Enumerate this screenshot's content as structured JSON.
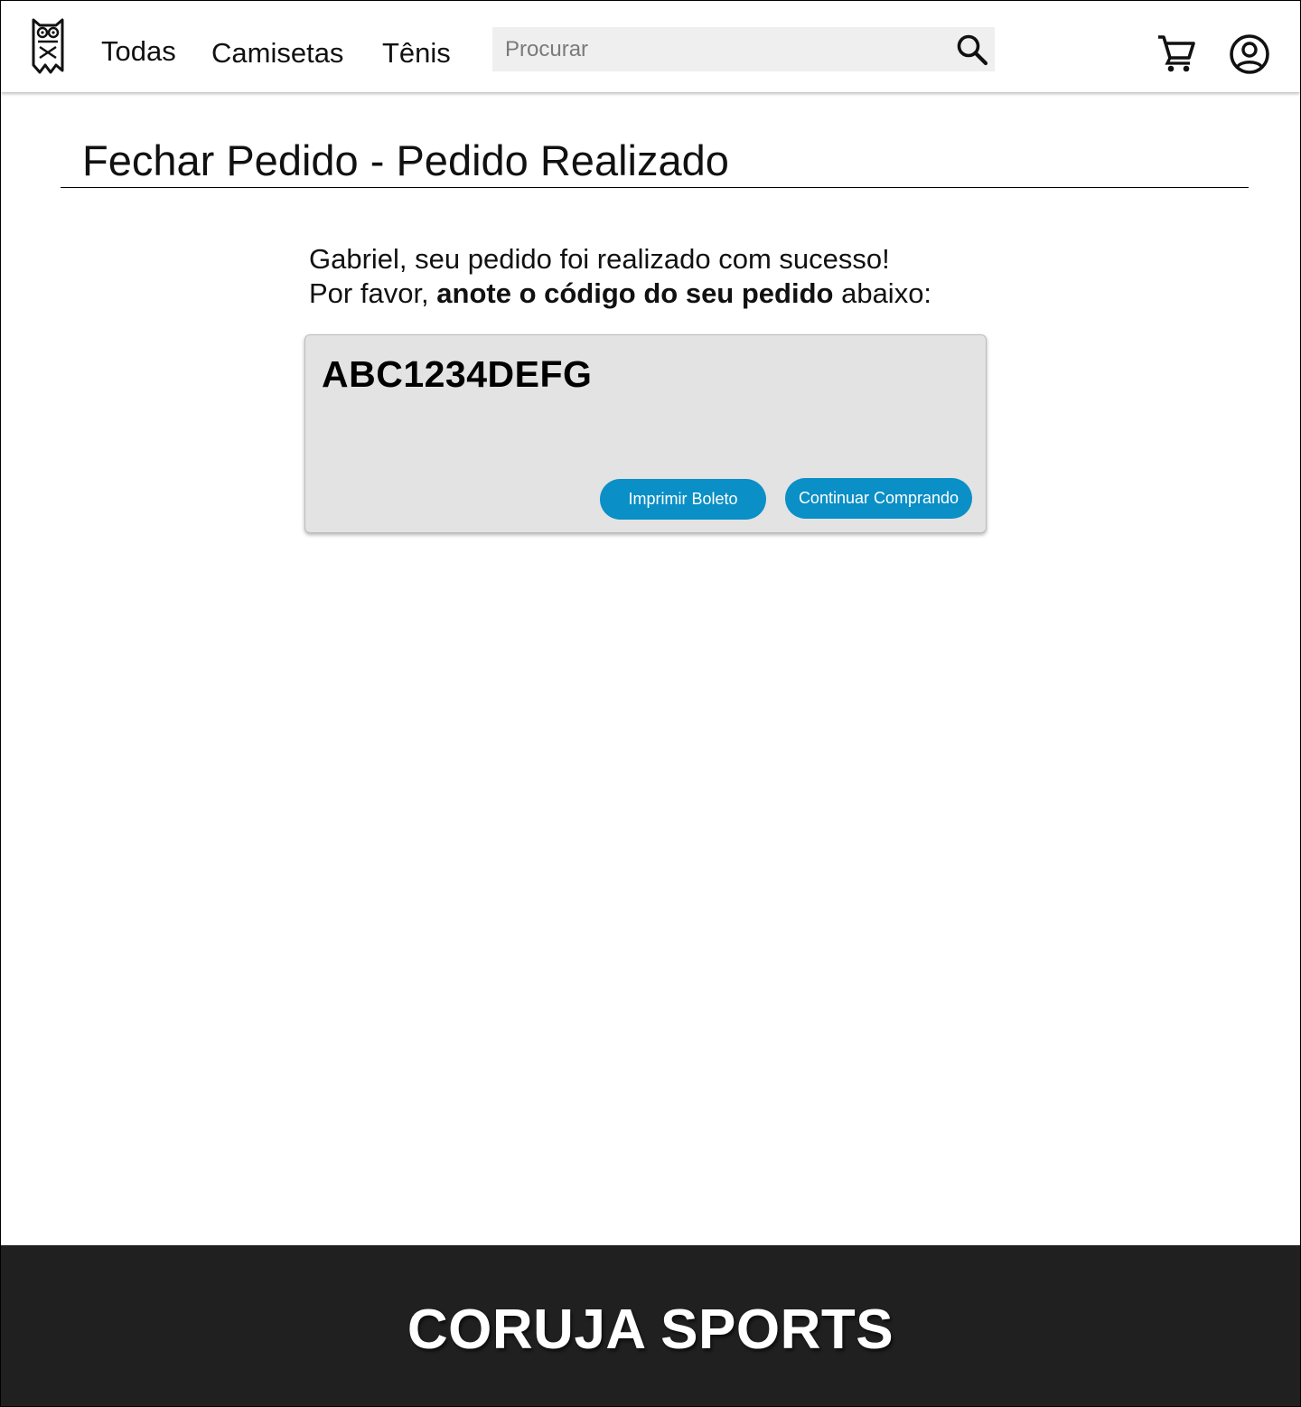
{
  "header": {
    "logo_icon": "owl-logo-icon",
    "nav": [
      {
        "label": "Todas"
      },
      {
        "label": "Camisetas"
      },
      {
        "label": "Tênis"
      }
    ],
    "search": {
      "placeholder": "Procurar",
      "value": "",
      "icon": "search-icon"
    },
    "cart_icon": "cart-icon",
    "account_icon": "account-circle-icon"
  },
  "page": {
    "title": "Fechar Pedido - Pedido Realizado",
    "message_line1": "Gabriel, seu pedido foi realizado com sucesso!",
    "message_line2_prefix": "Por favor, ",
    "message_line2_bold": "anote o código do seu pedido",
    "message_line2_suffix": " abaixo:"
  },
  "order": {
    "code": "ABC1234DEFG",
    "print_button": "Imprimir Boleto",
    "continue_button": "Continuar Comprando"
  },
  "footer": {
    "brand": "CORUJA SPORTS"
  },
  "colors": {
    "accent": "#0a8fc6",
    "card_bg": "#e3e3e3",
    "footer_bg": "#202020",
    "search_bg": "#efefef"
  }
}
